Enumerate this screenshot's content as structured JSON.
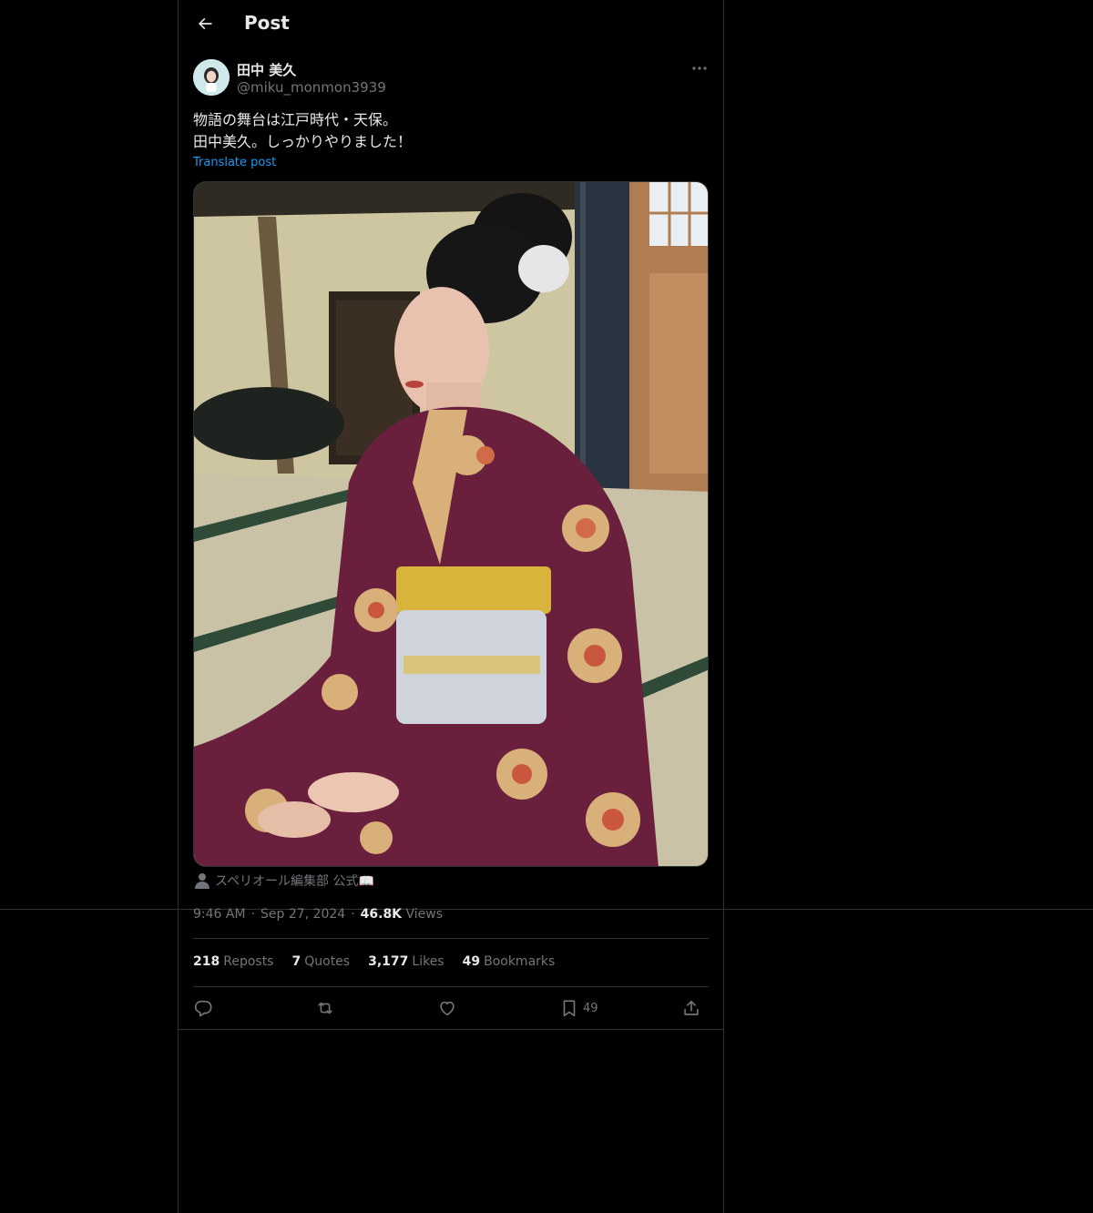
{
  "header": {
    "title": "Post"
  },
  "author": {
    "name": "田中 美久",
    "handle": "@miku_monmon3939"
  },
  "post": {
    "lines": [
      "物語の舞台は江戸時代・天保。",
      "田中美久。しっかりやりました！"
    ],
    "translate_label": "Translate post",
    "media_credit": "スペリオール編集部 公式📖"
  },
  "meta": {
    "time": "9:46 AM",
    "date": "Sep 27, 2024",
    "views_count": "46.8K",
    "views_label": "Views"
  },
  "stats": [
    {
      "count": "218",
      "label": "Reposts"
    },
    {
      "count": "7",
      "label": "Quotes"
    },
    {
      "count": "3,177",
      "label": "Likes"
    },
    {
      "count": "49",
      "label": "Bookmarks"
    }
  ],
  "actions": {
    "reply_icon": "reply-icon",
    "repost_icon": "repost-icon",
    "like_icon": "heart-icon",
    "bookmark_icon": "bookmark-icon",
    "bookmark_count": "49",
    "share_icon": "share-icon"
  },
  "colors": {
    "background": "#000000",
    "text": "#e7e9ea",
    "muted": "#71767b",
    "accent": "#1d9bf0",
    "border": "#2f3336"
  }
}
